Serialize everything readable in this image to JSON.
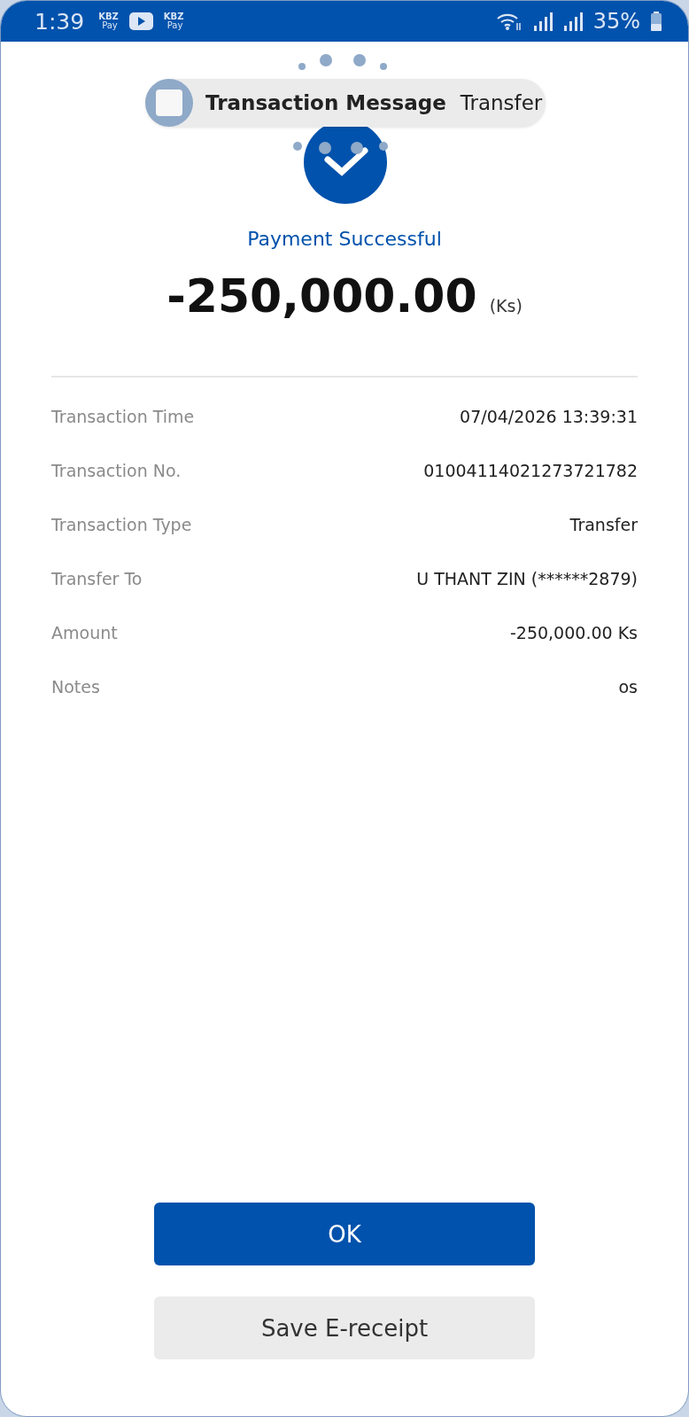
{
  "status_bar": {
    "time": "1:39",
    "notifications": [
      {
        "kind": "wallet",
        "label": "KBZ",
        "sublabel": "Pay"
      },
      {
        "kind": "video"
      },
      {
        "kind": "wallet",
        "label": "KBZ",
        "sublabel": "Pay"
      }
    ],
    "battery": "35%"
  },
  "toast": {
    "title": "Transaction Message",
    "text": "Transfer"
  },
  "status": {
    "title": "Payment Successful",
    "amount": "-250,000.00",
    "currency": "(Ks)"
  },
  "details": [
    {
      "label": "Transaction Time",
      "value": "07/04/2026 13:39:31"
    },
    {
      "label": "Transaction No.",
      "value": "01004114021273721782"
    },
    {
      "label": "Transaction Type",
      "value": "Transfer"
    },
    {
      "label": "Transfer To",
      "value": "U THANT ZIN (******2879)"
    },
    {
      "label": "Amount",
      "value": "-250,000.00 Ks"
    },
    {
      "label": "Notes",
      "value": "os"
    }
  ],
  "buttons": [
    {
      "kind": "primary",
      "label": "OK"
    },
    {
      "kind": "secondary",
      "label": "Save E-receipt"
    }
  ]
}
